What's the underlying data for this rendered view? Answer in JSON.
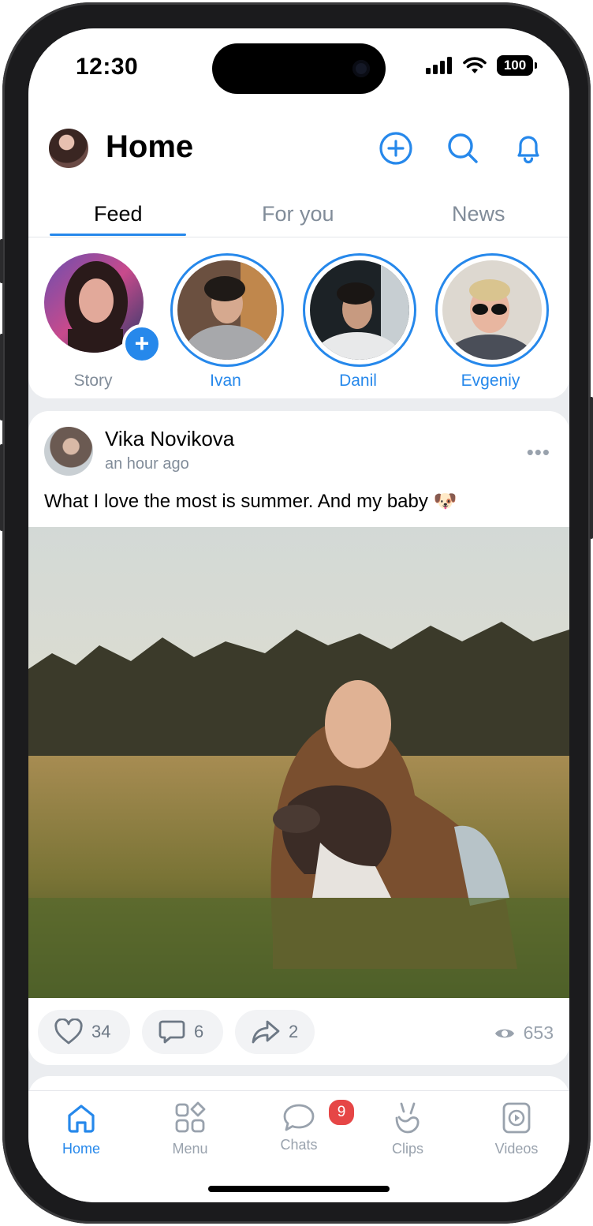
{
  "status": {
    "time": "12:30",
    "battery": "100"
  },
  "header": {
    "title": "Home"
  },
  "tabs": [
    {
      "label": "Feed"
    },
    {
      "label": "For you"
    },
    {
      "label": "News"
    }
  ],
  "stories": [
    {
      "name": "Story"
    },
    {
      "name": "Ivan"
    },
    {
      "name": "Danil"
    },
    {
      "name": "Evgeniy"
    }
  ],
  "post": {
    "author": "Vika Novikova",
    "time": "an hour ago",
    "text": "What I love the most is summer. And my baby 🐶",
    "likes": "34",
    "comments": "6",
    "shares": "2",
    "views": "653"
  },
  "tabbar": {
    "items": [
      {
        "label": "Home"
      },
      {
        "label": "Menu"
      },
      {
        "label": "Chats",
        "badge": "9"
      },
      {
        "label": "Clips"
      },
      {
        "label": "Videos"
      }
    ]
  },
  "colors": {
    "accent": "#2688eb",
    "badge": "#e64646",
    "secondary": "#818c99"
  }
}
